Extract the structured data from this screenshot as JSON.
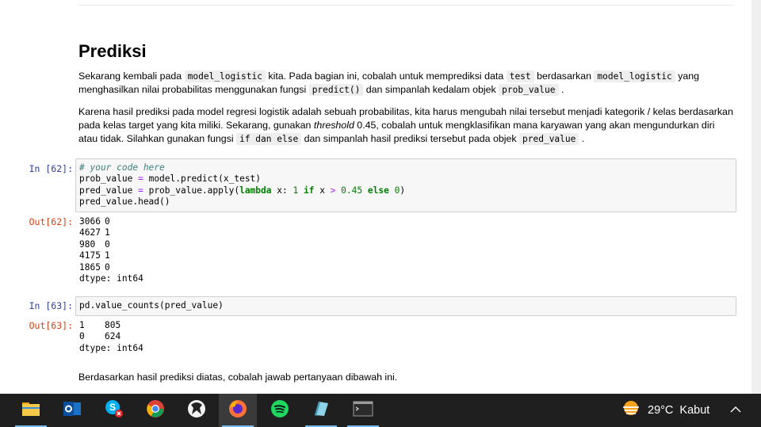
{
  "section_title": "Prediksi",
  "paragraph1": {
    "t1": "Sekarang kembali pada ",
    "c1": "model_logistic",
    "t2": " kita. Pada bagian ini, cobalah untuk memprediksi data ",
    "c2": "test",
    "t3": " berdasarkan ",
    "c3": "model_logistic",
    "t4": " yang menghasilkan nilai probabilitas menggunakan fungsi ",
    "c4": "predict()",
    "t5": " dan simpanlah kedalam objek ",
    "c5": "prob_value",
    "t6": " ."
  },
  "paragraph2": {
    "t1": "Karena hasil prediksi pada model regresi logistik adalah sebuah probabilitas, kita harus mengubah nilai tersebut menjadi kategorik / kelas berdasarkan pada kelas target yang kita miliki. Sekarang, gunakan ",
    "em": "threshold",
    "t2": " 0.45, cobalah untuk mengklasifikan mana karyawan yang akan mengundurkan diri atau tidak. Silahkan gunakan fungsi ",
    "c1": "if dan else",
    "t3": " dan simpanlah hasil prediksi tersebut pada objek ",
    "c2": "pred_value",
    "t4": " ."
  },
  "cell62": {
    "in_prompt": "In [62]:",
    "out_prompt": "Out[62]:",
    "code": {
      "comment": "# your code here",
      "l2a": "prob_value ",
      "l2op": "=",
      "l2b": " model.predict(x_test)",
      "l3a": "pred_value ",
      "l3op": "=",
      "l3b": " prob_value.apply(",
      "l3kw1": "lambda",
      "l3c": " x: ",
      "l3n1": "1",
      "l3sp1": " ",
      "l3kw2": "if",
      "l3d": " x ",
      "l3op2": ">",
      "l3sp2": " ",
      "l3n2": "0.45",
      "l3sp3": " ",
      "l3kw3": "else",
      "l3sp4": " ",
      "l3n3": "0",
      "l3e": ")",
      "l4": "pred_value.head()"
    },
    "output_rows": [
      {
        "index": "3066",
        "value": "0"
      },
      {
        "index": "4627",
        "value": "1"
      },
      {
        "index": "980",
        "value": "0"
      },
      {
        "index": "4175",
        "value": "1"
      },
      {
        "index": "1865",
        "value": "0"
      }
    ],
    "dtype": "dtype: int64"
  },
  "cell63": {
    "in_prompt": "In [63]:",
    "out_prompt": "Out[63]:",
    "code": "pd.value_counts(pred_value)",
    "output_rows": [
      {
        "index": "1",
        "value": "805"
      },
      {
        "index": "0",
        "value": "624"
      }
    ],
    "dtype": "dtype: int64"
  },
  "closing_text": "Berdasarkan hasil prediksi diatas, cobalah jawab pertanyaan dibawah ini.",
  "taskbar": {
    "apps": [
      {
        "name": "file-explorer-icon",
        "running": true,
        "active": false
      },
      {
        "name": "outlook-icon",
        "running": false,
        "active": false
      },
      {
        "name": "skype-icon",
        "running": false,
        "active": false
      },
      {
        "name": "chrome-icon",
        "running": false,
        "active": false
      },
      {
        "name": "inkscape-icon",
        "running": false,
        "active": false
      },
      {
        "name": "firefox-icon",
        "running": true,
        "active": true
      },
      {
        "name": "spotify-icon",
        "running": false,
        "active": false
      },
      {
        "name": "notes-icon",
        "running": true,
        "active": false
      },
      {
        "name": "terminal-icon",
        "running": true,
        "active": false
      }
    ],
    "weather": {
      "temperature": "29°C",
      "condition": "Kabut"
    }
  }
}
